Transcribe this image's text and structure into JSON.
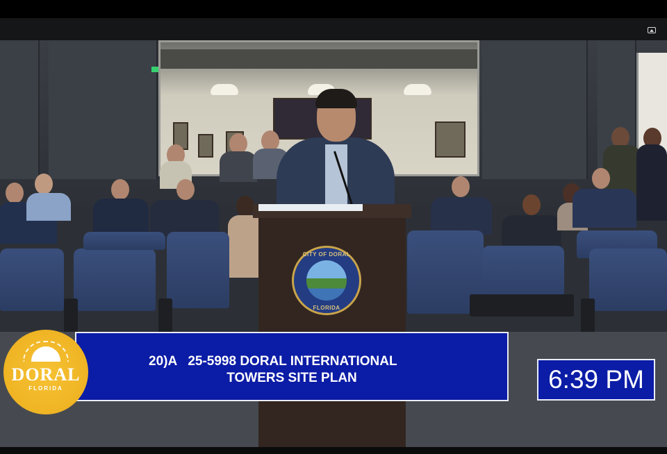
{
  "player": {
    "pip_button_icon": "picture-in-picture-icon"
  },
  "logo": {
    "name": "DORAL",
    "subtitle": "FLORIDA"
  },
  "seal": {
    "top_text": "CITY OF DORAL",
    "bottom_text": "FLORIDA"
  },
  "lower_third": {
    "line1": "20)A   25-5998 DORAL INTERNATIONAL",
    "line2": "TOWERS SITE PLAN"
  },
  "clock": {
    "time": "6:39 PM"
  },
  "colors": {
    "overlay_blue": "#0b1ca6",
    "logo_gold": "#f6c234",
    "seat_blue": "#3a4f7c"
  }
}
